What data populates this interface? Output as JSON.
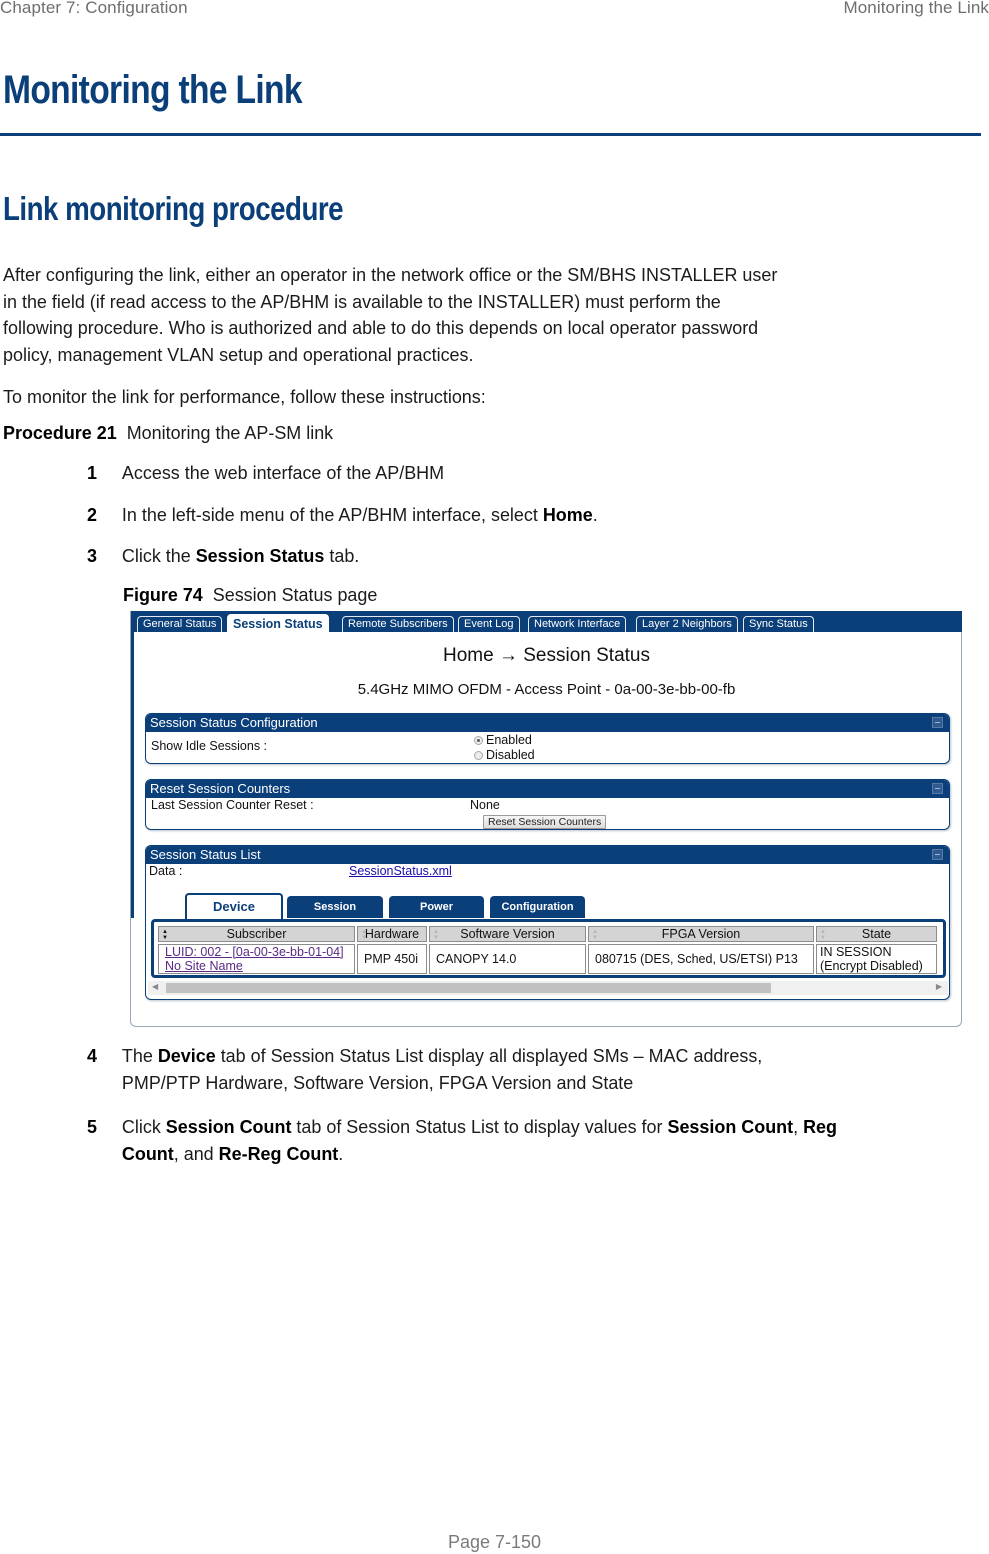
{
  "header": {
    "chapter": "Chapter 7:  Configuration",
    "section": "Monitoring the Link"
  },
  "title": "Monitoring the Link",
  "subtitle": "Link monitoring procedure",
  "intro": [
    "After configuring the link, either an operator in the network office or the SM/BHS INSTALLER user",
    "in the field (if read access to the AP/BHM is available to the INSTALLER) must perform the",
    "following procedure. Who is authorized and able to do this depends on local operator password",
    "policy, management VLAN setup and operational practices."
  ],
  "instructions_intro": "To monitor the link for performance, follow these instructions:",
  "procedure": {
    "label": "Procedure 21",
    "title": "Monitoring the AP-SM link"
  },
  "steps": [
    {
      "num": "1",
      "text": "Access the web interface of the AP/BHM"
    },
    {
      "num": "2",
      "pre": "In the left-side menu of the AP/BHM interface, select ",
      "bold": "Home",
      "post": "."
    },
    {
      "num": "3",
      "pre": "Click the ",
      "bold": "Session Status",
      "post": " tab."
    },
    {
      "num": "4",
      "line1_pre": "The ",
      "line1_bold": "Device",
      "line1_post": " tab of Session Status List display all displayed SMs – MAC address,",
      "line2": "PMP/PTP Hardware, Software Version, FPGA Version and State"
    },
    {
      "num": "5",
      "line1_pre": "Click ",
      "b1": "Session Count",
      "mid1": " tab of Session Status List to display values for ",
      "b2": "Session Count",
      "mid2": ", ",
      "b3": "Reg",
      "b4": "Count",
      "mid3": ", and ",
      "b5": "Re-Reg Count",
      "end": "."
    }
  ],
  "figure": {
    "label": "Figure 74",
    "caption": "Session Status page"
  },
  "screenshot": {
    "top_tabs": [
      "General Status",
      "Session Status",
      "Remote Subscribers",
      "Event Log",
      "Network Interface",
      "Layer 2 Neighbors",
      "Sync Status"
    ],
    "active_tab": "Session Status",
    "breadcrumb": "Home → Session Status",
    "device_line": "5.4GHz MIMO OFDM - Access Point - 0a-00-3e-bb-00-fb",
    "config_panel": {
      "title": "Session Status Configuration",
      "label": "Show Idle Sessions :",
      "options": [
        "Enabled",
        "Disabled"
      ],
      "selected": "Enabled"
    },
    "reset_panel": {
      "title": "Reset Session Counters",
      "label": "Last Session Counter Reset :",
      "value": "None",
      "button": "Reset Session Counters"
    },
    "list_panel": {
      "title": "Session Status List",
      "data_label": "Data :",
      "data_link": "SessionStatus.xml",
      "tabs": [
        "Device",
        "Session",
        "Power",
        "Configuration"
      ],
      "active_tab": "Device",
      "columns": [
        "Subscriber",
        "Hardware",
        "Software Version",
        "FPGA Version",
        "State"
      ],
      "rows": [
        {
          "subscriber_line1": "LUID: 002 - [0a-00-3e-bb-01-04]",
          "subscriber_line2": "No Site Name",
          "hardware": "PMP 450i",
          "software": "CANOPY 14.0",
          "fpga": "080715 (DES, Sched, US/ETSI) P13",
          "state_line1": "IN SESSION",
          "state_line2": "(Encrypt Disabled)"
        }
      ]
    }
  },
  "footer": {
    "page": "Page 7-150"
  },
  "colors": {
    "brand_blue": "#0b3f7a",
    "header_gray": "#6e6e6e"
  }
}
